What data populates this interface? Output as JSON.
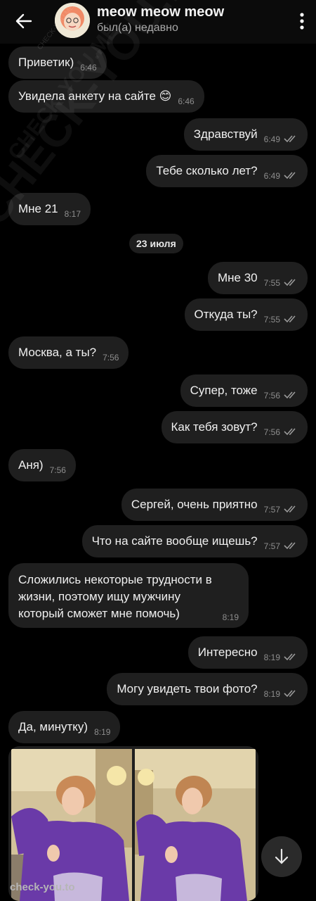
{
  "header": {
    "title": "meow meow meow",
    "status": "был(а) недавно"
  },
  "date_separator": "23 июля",
  "messages": [
    {
      "dir": "in",
      "text": "Приветик)",
      "time": "6:46"
    },
    {
      "dir": "in",
      "text": "Увидела анкету на сайте 😊",
      "time": "6:46"
    },
    {
      "dir": "out",
      "text": "Здравствуй",
      "time": "6:49",
      "read": true
    },
    {
      "dir": "out",
      "text": "Тебе сколько лет?",
      "time": "6:49",
      "read": true
    },
    {
      "dir": "in",
      "text": "Мне 21",
      "time": "8:17"
    },
    {
      "dir": "out",
      "text": "Мне 30",
      "time": "7:55",
      "read": true
    },
    {
      "dir": "out",
      "text": "Откуда ты?",
      "time": "7:55",
      "read": true
    },
    {
      "dir": "in",
      "text": "Москва, а ты?",
      "time": "7:56"
    },
    {
      "dir": "out",
      "text": "Супер, тоже",
      "time": "7:56",
      "read": true
    },
    {
      "dir": "out",
      "text": "Как тебя зовут?",
      "time": "7:56",
      "read": true
    },
    {
      "dir": "in",
      "text": "Аня)",
      "time": "7:56"
    },
    {
      "dir": "out",
      "text": "Сергей, очень приятно",
      "time": "7:57",
      "read": true
    },
    {
      "dir": "out",
      "text": "Что на сайте вообще ищешь?",
      "time": "7:57",
      "read": true
    },
    {
      "dir": "in",
      "text": "Сложились некоторые трудности в жизни, поэтому ищу мужчину который сможет мне помочь)",
      "time": "8:19"
    },
    {
      "dir": "out",
      "text": "Интересно",
      "time": "8:19",
      "read": true
    },
    {
      "dir": "out",
      "text": "Могу увидеть твои фото?",
      "time": "8:19",
      "read": true
    },
    {
      "dir": "in",
      "text": "Да, минутку)",
      "time": "8:19"
    }
  ],
  "watermarks": {
    "big": "CHECK-YOU.ME",
    "small": "CHECK-YOU.ME",
    "tiny": "CHECK-YOU.ME",
    "bottom": "check-you.to"
  },
  "icons": {
    "back": "arrow-left-icon",
    "menu": "more-vertical-icon",
    "read": "double-check-icon",
    "scroll": "arrow-down-icon"
  },
  "colors": {
    "background": "#000000",
    "bubble": "#1f1f1f",
    "sweater": "#6a3aa8",
    "wall": "#d8c9a2"
  }
}
